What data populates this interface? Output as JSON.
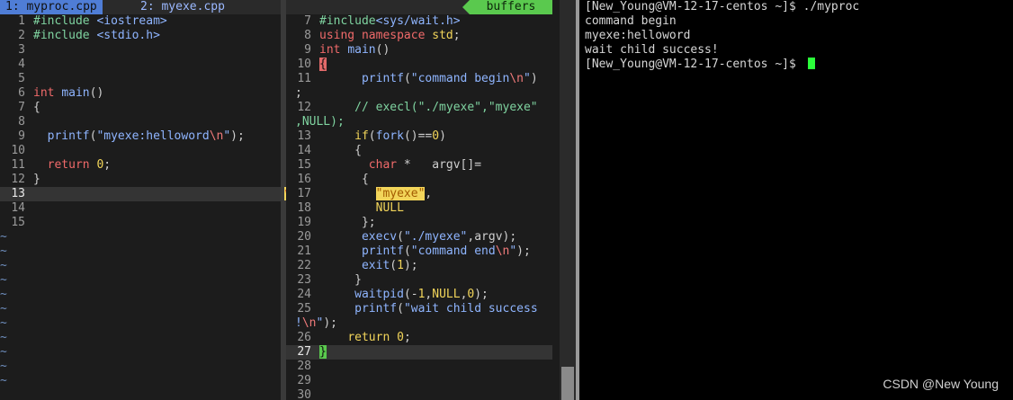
{
  "vim": {
    "tabs": [
      {
        "label": "1: myproc.cpp"
      },
      {
        "label": "2: myexe.cpp"
      }
    ],
    "buffers_label": "buffers",
    "split_marker": "W>",
    "left_pane": {
      "lines": [
        {
          "num": "1",
          "code": "#include <iostream>"
        },
        {
          "num": "2",
          "code": "#include <stdio.h>"
        },
        {
          "num": "3",
          "code": ""
        },
        {
          "num": "4",
          "code": ""
        },
        {
          "num": "5",
          "code": ""
        },
        {
          "num": "6",
          "code": "int main()"
        },
        {
          "num": "7",
          "code": "{"
        },
        {
          "num": "8",
          "code": ""
        },
        {
          "num": "9",
          "code": "  printf(\"myexe:helloword\\n\");"
        },
        {
          "num": "10",
          "code": ""
        },
        {
          "num": "11",
          "code": "  return 0;"
        },
        {
          "num": "12",
          "code": "}"
        },
        {
          "num": "13",
          "code": ""
        },
        {
          "num": "14",
          "code": ""
        },
        {
          "num": "15",
          "code": ""
        }
      ],
      "tilde": "~"
    },
    "right_pane": {
      "lines": [
        {
          "num": "7",
          "code": "#include<sys/wait.h>"
        },
        {
          "num": "8",
          "code": "using namespace std;"
        },
        {
          "num": "9",
          "code": "int main()"
        },
        {
          "num": "10",
          "code": "{"
        },
        {
          "num": "11",
          "code": "      printf(\"command begin\\n\")"
        },
        {
          "num": "",
          "code": ";"
        },
        {
          "num": "12",
          "code": "     // execl(\"./myexe\",\"myexe\""
        },
        {
          "num": "",
          "code": ",NULL);"
        },
        {
          "num": "13",
          "code": "     if(fork()==0)"
        },
        {
          "num": "14",
          "code": "     {"
        },
        {
          "num": "15",
          "code": "       char *   argv[]="
        },
        {
          "num": "16",
          "code": "      {"
        },
        {
          "num": "17",
          "code": "        \"myexe\","
        },
        {
          "num": "18",
          "code": "        NULL"
        },
        {
          "num": "19",
          "code": "      };"
        },
        {
          "num": "20",
          "code": "      execv(\"./myexe\",argv);"
        },
        {
          "num": "21",
          "code": "      printf(\"command end\\n\");"
        },
        {
          "num": "22",
          "code": "      exit(1);"
        },
        {
          "num": "23",
          "code": "     }"
        },
        {
          "num": "24",
          "code": "     waitpid(-1,NULL,0);"
        },
        {
          "num": "25",
          "code": "     printf(\"wait child success"
        },
        {
          "num": "",
          "code": "!\\n\");"
        },
        {
          "num": "26",
          "code": "    return 0;"
        },
        {
          "num": "27",
          "code": "}"
        },
        {
          "num": "28",
          "code": ""
        },
        {
          "num": "29",
          "code": ""
        },
        {
          "num": "30",
          "code": ""
        }
      ]
    }
  },
  "terminal": {
    "lines": [
      "[New_Young@VM-12-17-centos ~]$ ./myproc",
      "command begin",
      "myexe:helloword",
      "wait child success!",
      "[New_Young@VM-12-17-centos ~]$ "
    ]
  },
  "watermark": "CSDN @New  Young",
  "colors": {
    "tab_active": "#4f7dd6",
    "buffers": "#5ac94e",
    "cursor": "#2bff3a",
    "highlight": "#f2d55a"
  }
}
